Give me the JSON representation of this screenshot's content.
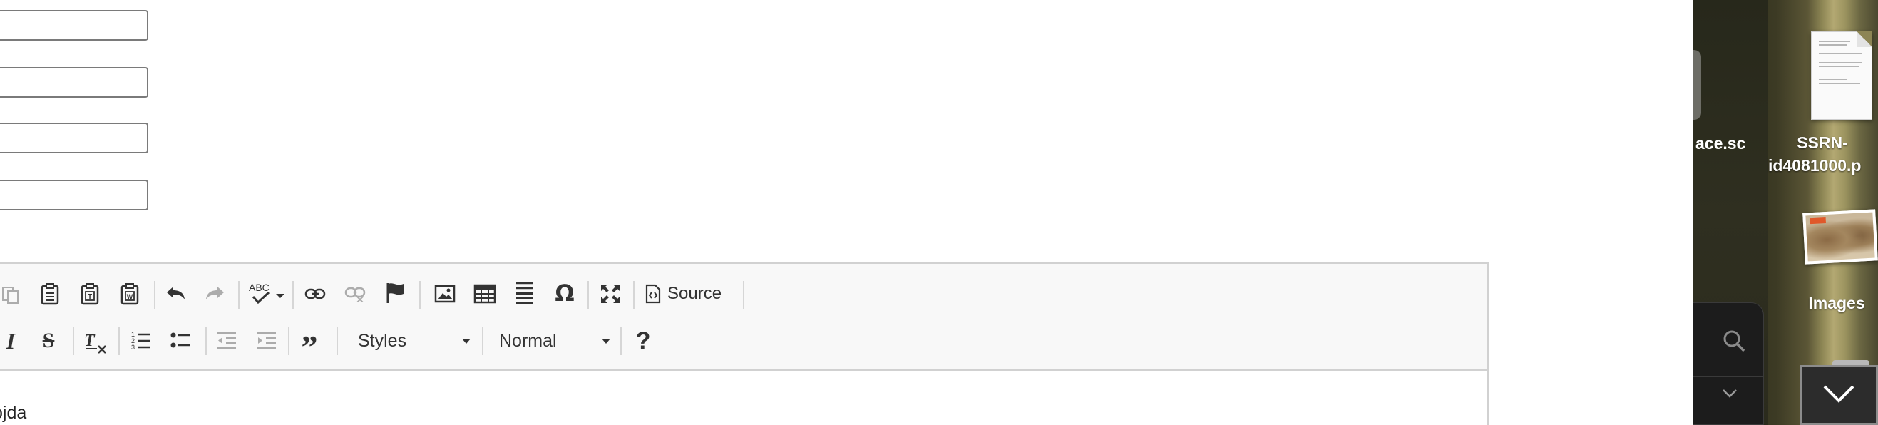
{
  "form": {
    "fields": [
      "",
      "",
      "",
      ""
    ]
  },
  "editor": {
    "toolbar_row1": {
      "source_label": "Source",
      "icons": [
        "copy-icon",
        "paste-icon",
        "paste-text-icon",
        "paste-from-word-icon",
        "undo-icon",
        "redo-icon",
        "spellcheck-icon",
        "link-icon",
        "unlink-icon",
        "anchor-flag-icon",
        "image-icon",
        "table-icon",
        "horizontal-line-icon",
        "special-char-omega-icon",
        "maximize-icon",
        "source-icon"
      ]
    },
    "toolbar_row2": {
      "styles_label": "Styles",
      "format_label": "Normal",
      "icons": [
        "italic-icon",
        "strikethrough-icon",
        "remove-format-icon",
        "numbered-list-icon",
        "bulleted-list-icon",
        "decrease-indent-icon",
        "increase-indent-icon",
        "blockquote-icon",
        "help-icon"
      ]
    },
    "content_text": "ojda"
  },
  "desktop": {
    "left_label": "ace.sc",
    "file_label_line1": "SSRN-",
    "file_label_line2": "id4081000.p",
    "images_label": "Images"
  },
  "colors": {
    "toolbar_bg": "#f8f8f8",
    "border": "#d1d1d1",
    "icon": "#333333",
    "desktop_label": "#ffffff"
  }
}
